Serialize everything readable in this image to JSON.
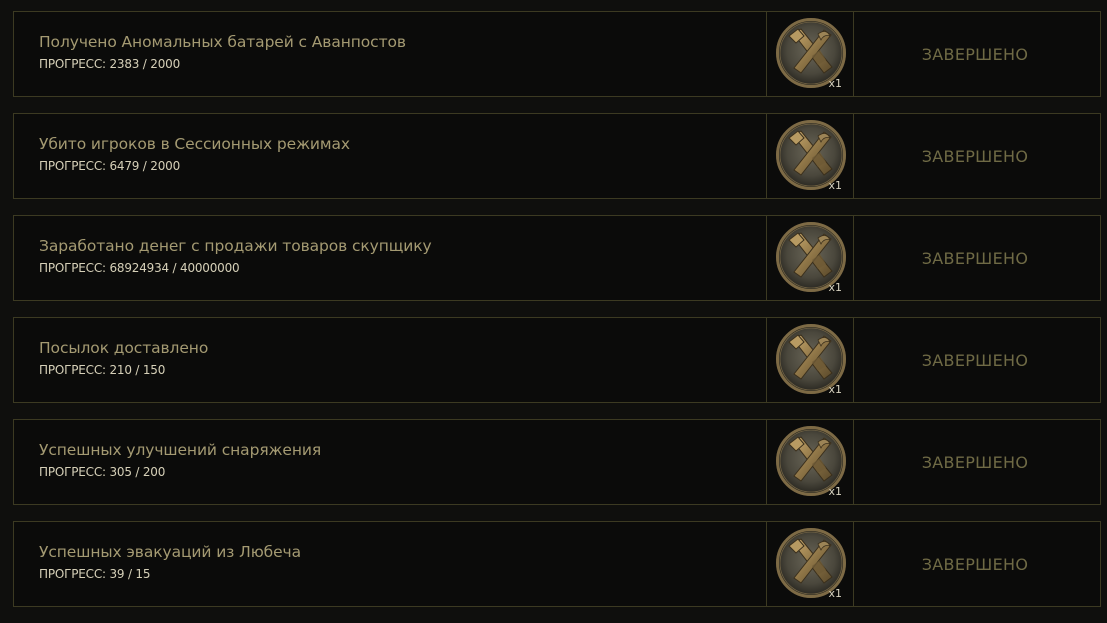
{
  "achievements": [
    {
      "title": "Получено Аномальных батарей с Аванпостов",
      "progress": "ПРОГРЕСС: 2383 / 2000",
      "reward_qty": "x1",
      "status": "ЗАВЕРШЕНО",
      "reward_icon": "crossed-tools-coin-icon"
    },
    {
      "title": "Убито игроков в Сессионных режимах",
      "progress": "ПРОГРЕСС: 6479 / 2000",
      "reward_qty": "x1",
      "status": "ЗАВЕРШЕНО",
      "reward_icon": "crossed-tools-coin-icon"
    },
    {
      "title": "Заработано денег с продажи товаров скупщику",
      "progress": "ПРОГРЕСС: 68924934 / 40000000",
      "reward_qty": "x1",
      "status": "ЗАВЕРШЕНО",
      "reward_icon": "crossed-tools-coin-icon"
    },
    {
      "title": "Посылок доставлено",
      "progress": "ПРОГРЕСС: 210 / 150",
      "reward_qty": "x1",
      "status": "ЗАВЕРШЕНО",
      "reward_icon": "crossed-tools-coin-icon"
    },
    {
      "title": "Успешных улучшений снаряжения",
      "progress": "ПРОГРЕСС: 305 / 200",
      "reward_qty": "x1",
      "status": "ЗАВЕРШЕНО",
      "reward_icon": "crossed-tools-coin-icon"
    },
    {
      "title": "Успешных эвакуаций из Любеча",
      "progress": "ПРОГРЕСС: 39 / 15",
      "reward_qty": "x1",
      "status": "ЗАВЕРШЕНО",
      "reward_icon": "crossed-tools-coin-icon"
    }
  ],
  "colors": {
    "background": "#0f0f0d",
    "border": "#3c3a22",
    "title": "#a49a72",
    "progress": "#d6d0b8",
    "status": "#6f6a45",
    "coin_bronze": "#8b7a4f"
  }
}
